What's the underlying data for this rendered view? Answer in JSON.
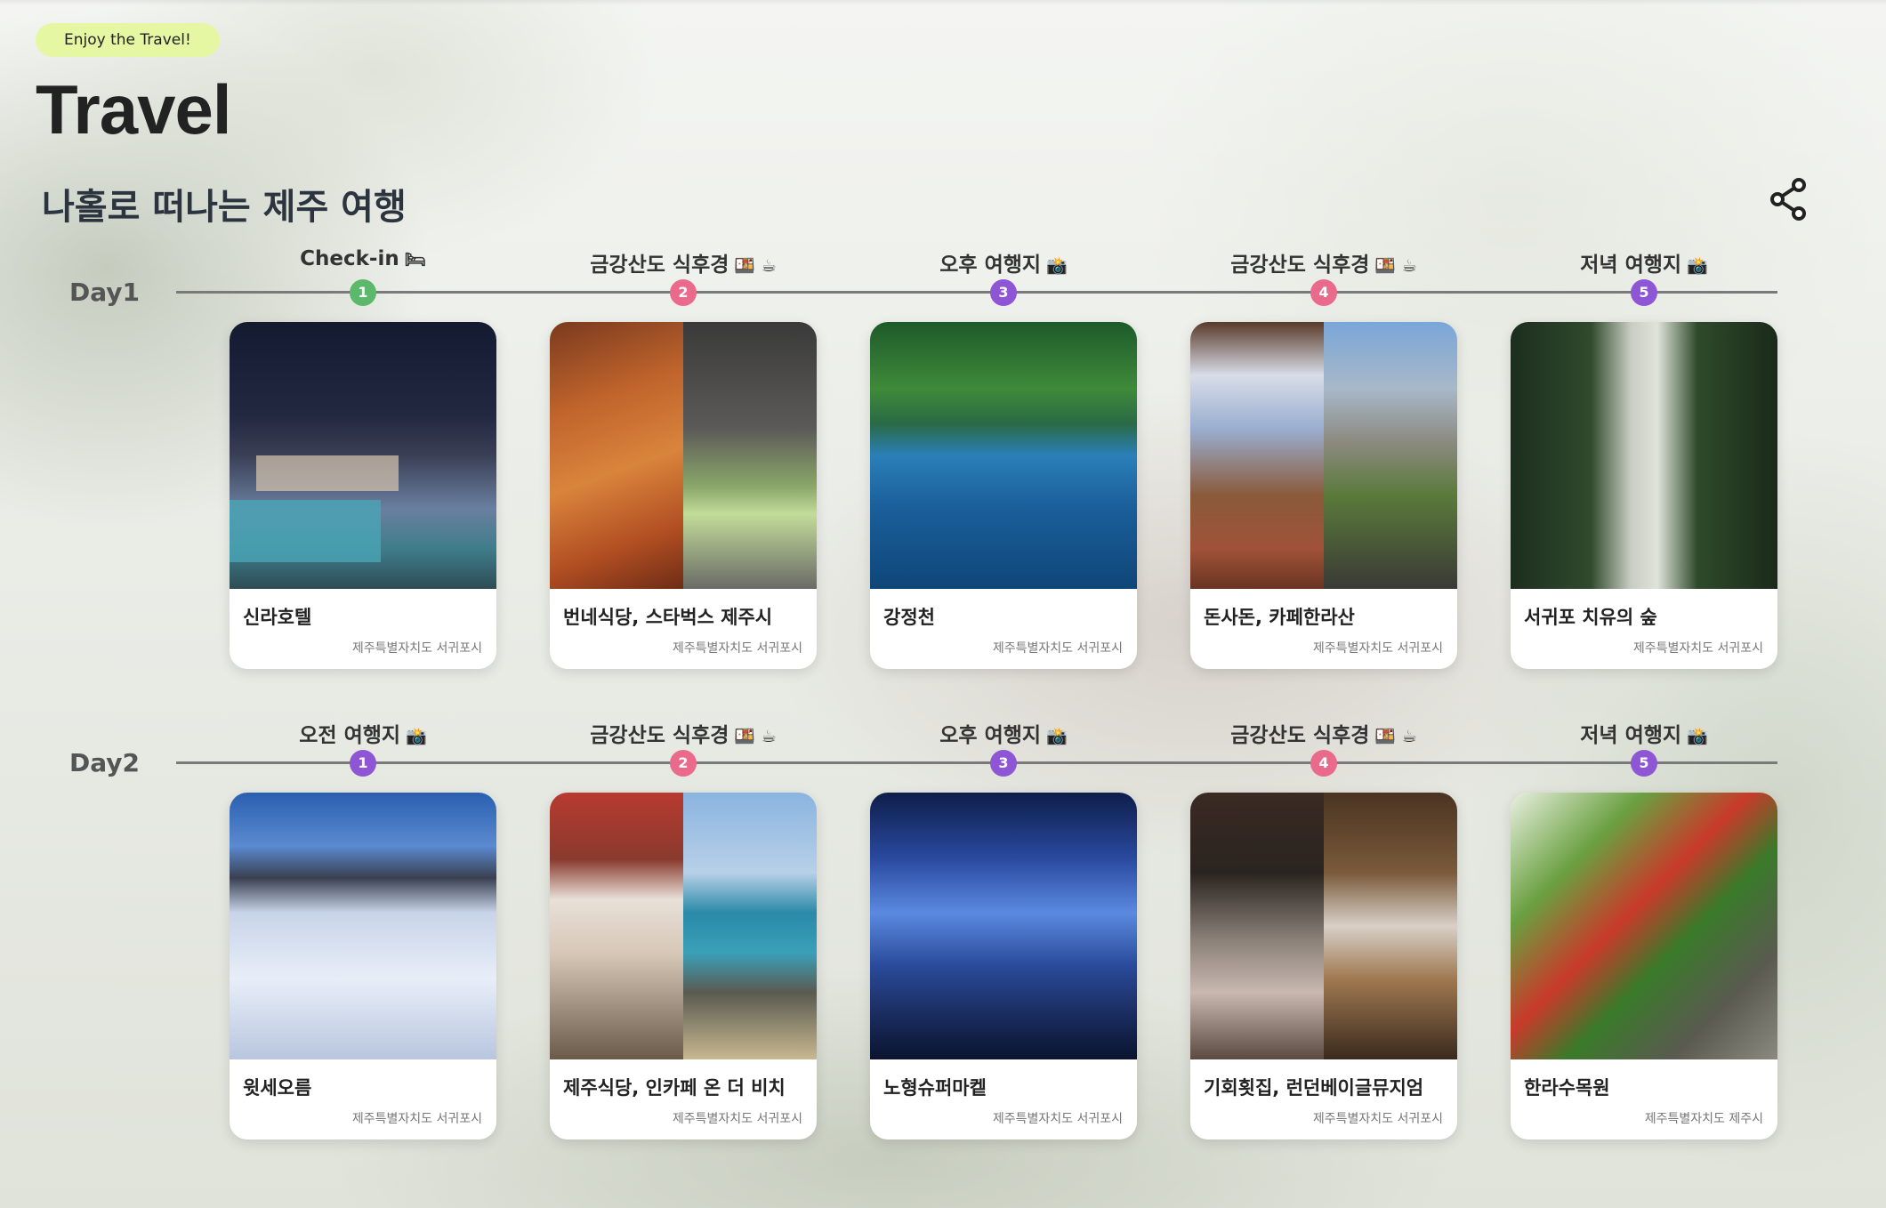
{
  "badge": "Enjoy the Travel!",
  "app_title": "Travel",
  "trip_title": "나홀로 떠나는 제주 여행",
  "share_icon": "share-icon",
  "colors": {
    "green": "#5cb86a",
    "pink": "#ea6a8c",
    "purple": "#8e56d4",
    "badge": "#e6f7a3"
  },
  "days": [
    {
      "label": "Day1",
      "stops": [
        {
          "title": "Check-in",
          "emoji": "🛏",
          "num": "1",
          "color": "green",
          "name": "신라호텔",
          "addr": "제주특별자치도 서귀포시"
        },
        {
          "title": "금강산도 식후경",
          "emoji": "🍱 ☕",
          "num": "2",
          "color": "pink",
          "name": "번네식당, 스타벅스 제주시",
          "addr": "제주특별자치도 서귀포시"
        },
        {
          "title": "오후 여행지",
          "emoji": "📸",
          "num": "3",
          "color": "purple",
          "name": "강정천",
          "addr": "제주특별자치도 서귀포시"
        },
        {
          "title": "금강산도 식후경",
          "emoji": "🍱 ☕",
          "num": "4",
          "color": "pink",
          "name": "돈사돈, 카페한라산",
          "addr": "제주특별자치도 서귀포시"
        },
        {
          "title": "저녁 여행지",
          "emoji": "📸",
          "num": "5",
          "color": "purple",
          "name": "서귀포 치유의 숲",
          "addr": "제주특별자치도 서귀포시"
        }
      ]
    },
    {
      "label": "Day2",
      "stops": [
        {
          "title": "오전 여행지",
          "emoji": "📸",
          "num": "1",
          "color": "purple",
          "name": "윗세오름",
          "addr": "제주특별자치도 서귀포시"
        },
        {
          "title": "금강산도 식후경",
          "emoji": "🍱 ☕",
          "num": "2",
          "color": "pink",
          "name": "제주식당, 인카페 온 더 비치",
          "addr": "제주특별자치도 서귀포시"
        },
        {
          "title": "오후 여행지",
          "emoji": "📸",
          "num": "3",
          "color": "purple",
          "name": "노형슈퍼마켙",
          "addr": "제주특별자치도 서귀포시"
        },
        {
          "title": "금강산도 식후경",
          "emoji": "🍱 ☕",
          "num": "4",
          "color": "pink",
          "name": "기회횟집, 런던베이글뮤지엄",
          "addr": "제주특별자치도 서귀포시"
        },
        {
          "title": "저녁 여행지",
          "emoji": "📸",
          "num": "5",
          "color": "purple",
          "name": "한라수목원",
          "addr": "제주특별자치도 제주시"
        }
      ]
    }
  ]
}
